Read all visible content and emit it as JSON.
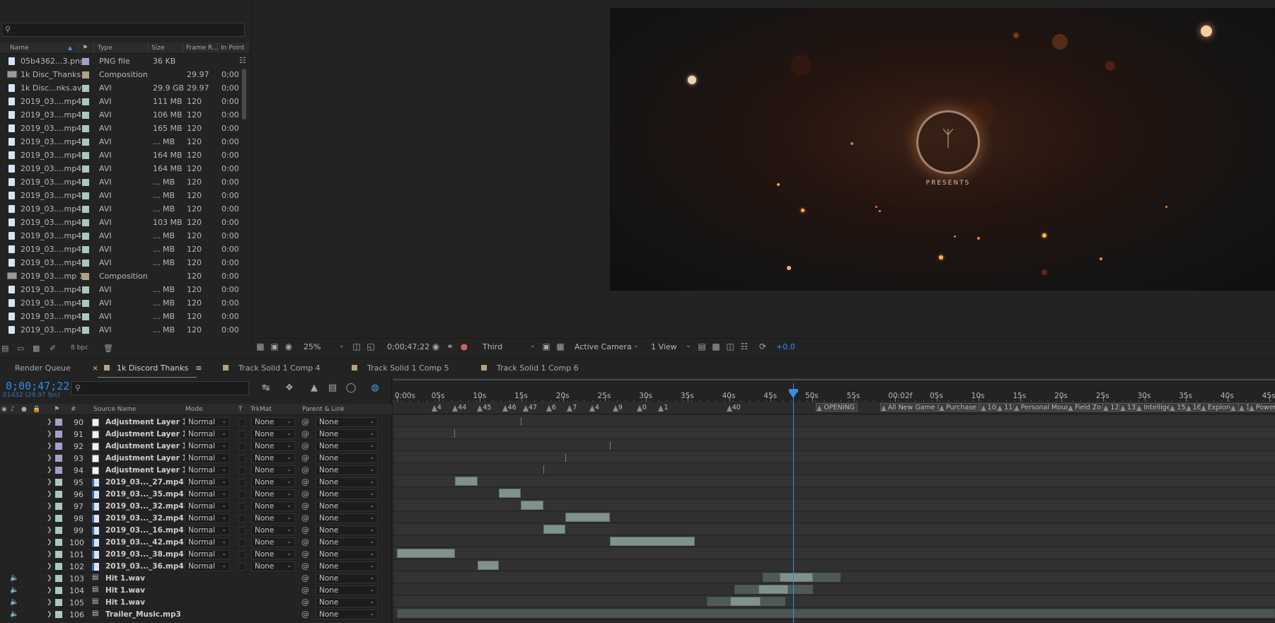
{
  "project": {
    "search_placeholder": "",
    "headers": {
      "name": "Name",
      "type": "Type",
      "size": "Size",
      "frame_rate": "Frame R...",
      "in_point": "In Point"
    },
    "items": [
      {
        "name": "05b4362...3.png",
        "type": "PNG file",
        "size": "36 KB",
        "rate": "",
        "in": "",
        "kind": "file",
        "label": "#a89fc8"
      },
      {
        "name": "1k Disc_Thanks",
        "type": "Composition",
        "size": "",
        "rate": "29.97",
        "in": "0;00",
        "kind": "comp",
        "label": "#b39e84"
      },
      {
        "name": "1k Disc...nks.avi",
        "type": "AVI",
        "size": "29.9 GB",
        "rate": "29.97",
        "in": "0;00",
        "kind": "file",
        "label": "#a9c9bd"
      },
      {
        "name": "2019_03....mp4",
        "type": "AVI",
        "size": "111 MB",
        "rate": "120",
        "in": "0:00",
        "kind": "file",
        "label": "#a9c9bd"
      },
      {
        "name": "2019_03....mp4",
        "type": "AVI",
        "size": "106 MB",
        "rate": "120",
        "in": "0:00",
        "kind": "file",
        "label": "#a9c9bd"
      },
      {
        "name": "2019_03....mp4",
        "type": "AVI",
        "size": "165 MB",
        "rate": "120",
        "in": "0:00",
        "kind": "file",
        "label": "#a9c9bd"
      },
      {
        "name": "2019_03....mp4",
        "type": "AVI",
        "size": "... MB",
        "rate": "120",
        "in": "0:00",
        "kind": "file",
        "label": "#a9c9bd"
      },
      {
        "name": "2019_03....mp4",
        "type": "AVI",
        "size": "164 MB",
        "rate": "120",
        "in": "0:00",
        "kind": "file",
        "label": "#a9c9bd"
      },
      {
        "name": "2019_03....mp4",
        "type": "AVI",
        "size": "164 MB",
        "rate": "120",
        "in": "0:00",
        "kind": "file",
        "label": "#a9c9bd"
      },
      {
        "name": "2019_03....mp4",
        "type": "AVI",
        "size": "... MB",
        "rate": "120",
        "in": "0:00",
        "kind": "file",
        "label": "#a9c9bd"
      },
      {
        "name": "2019_03....mp4",
        "type": "AVI",
        "size": "... MB",
        "rate": "120",
        "in": "0:00",
        "kind": "file",
        "label": "#a9c9bd"
      },
      {
        "name": "2019_03....mp4",
        "type": "AVI",
        "size": "... MB",
        "rate": "120",
        "in": "0:00",
        "kind": "file",
        "label": "#a9c9bd"
      },
      {
        "name": "2019_03....mp4",
        "type": "AVI",
        "size": "103 MB",
        "rate": "120",
        "in": "0:00",
        "kind": "file",
        "label": "#a9c9bd"
      },
      {
        "name": "2019_03....mp4",
        "type": "AVI",
        "size": "... MB",
        "rate": "120",
        "in": "0:00",
        "kind": "file",
        "label": "#a9c9bd"
      },
      {
        "name": "2019_03....mp4",
        "type": "AVI",
        "size": "... MB",
        "rate": "120",
        "in": "0:00",
        "kind": "file",
        "label": "#a9c9bd"
      },
      {
        "name": "2019_03....mp4",
        "type": "AVI",
        "size": "... MB",
        "rate": "120",
        "in": "0:00",
        "kind": "file",
        "label": "#a9c9bd"
      },
      {
        "name": "2019_03....mp 1",
        "type": "Composition",
        "size": "",
        "rate": "120",
        "in": "0:00",
        "kind": "comp",
        "label": "#b39e84"
      },
      {
        "name": "2019_03....mp4",
        "type": "AVI",
        "size": "... MB",
        "rate": "120",
        "in": "0:00",
        "kind": "file",
        "label": "#a9c9bd"
      },
      {
        "name": "2019_03....mp4",
        "type": "AVI",
        "size": "... MB",
        "rate": "120",
        "in": "0:00",
        "kind": "file",
        "label": "#a9c9bd"
      },
      {
        "name": "2019_03....mp4",
        "type": "AVI",
        "size": "... MB",
        "rate": "120",
        "in": "0:00",
        "kind": "file",
        "label": "#a9c9bd"
      },
      {
        "name": "2019_03....mp4",
        "type": "AVI",
        "size": "... MB",
        "rate": "120",
        "in": "0:00",
        "kind": "file",
        "label": "#a9c9bd"
      }
    ],
    "bpc": "8 bpc"
  },
  "viewer": {
    "presents": "PRESENTS",
    "zoom": "25%",
    "timecode": "0;00;47;22",
    "resolution": "Third",
    "camera": "Active Camera",
    "views": "1 View",
    "exposure": "+0.0"
  },
  "tabs": [
    {
      "label": "Render Queue",
      "has_square": false
    },
    {
      "label": "1k Discord Thanks",
      "has_square": true,
      "active": true
    },
    {
      "label": "Track Solid 1 Comp 4",
      "has_square": true
    },
    {
      "label": "Track Solid 1 Comp 5",
      "has_square": true
    },
    {
      "label": "Track Solid 1 Comp 6",
      "has_square": true
    }
  ],
  "timeline": {
    "timecode": "0;00;47;22",
    "frame_info": "01432 (29.97 fps)",
    "headers": {
      "num": "#",
      "source": "Source Name",
      "mode": "Mode",
      "t": "T",
      "trkmat": "TrkMat",
      "parent": "Parent & Link"
    },
    "ruler_labels": [
      "0:00s",
      "05s",
      "10s",
      "15s",
      "20s",
      "25s",
      "30s",
      "35s",
      "40s",
      "45s",
      "50s",
      "55s",
      "00:02f",
      "05s",
      "10s",
      "15s",
      "20s",
      "25s",
      "30s",
      "35s",
      "40s",
      "45s"
    ],
    "markers": [
      {
        "t": 4.5,
        "label": "4",
        "box": false
      },
      {
        "t": 7.0,
        "label": "44",
        "box": false
      },
      {
        "t": 10.0,
        "label": "45",
        "box": false
      },
      {
        "t": 13.0,
        "label": "46",
        "box": false
      },
      {
        "t": 15.5,
        "label": "47",
        "box": false
      },
      {
        "t": 18.3,
        "label": "6",
        "box": false
      },
      {
        "t": 20.8,
        "label": "7",
        "box": false
      },
      {
        "t": 23.5,
        "label": "4",
        "box": false
      },
      {
        "t": 26.3,
        "label": "9",
        "box": false
      },
      {
        "t": 29.2,
        "label": "0",
        "box": false
      },
      {
        "t": 31.8,
        "label": "1",
        "box": false
      },
      {
        "t": 40.0,
        "label": "40",
        "box": false
      },
      {
        "t": 50.8,
        "label": "OPENING",
        "box": true
      },
      {
        "t": 58.5,
        "label": "All New Game Mo",
        "box": true
      },
      {
        "t": 65.5,
        "label": "Purchase",
        "box": true
      },
      {
        "t": 70.5,
        "label": "10",
        "box": true
      },
      {
        "t": 72.5,
        "label": "11",
        "box": true
      },
      {
        "t": 74.5,
        "label": "Personal Mount",
        "box": true
      },
      {
        "t": 81.0,
        "label": "Field Zo",
        "box": true
      },
      {
        "t": 85.3,
        "label": "12",
        "box": true
      },
      {
        "t": 87.3,
        "label": "13",
        "box": true
      },
      {
        "t": 89.3,
        "label": "Intellige",
        "box": true
      },
      {
        "t": 93.3,
        "label": "15",
        "box": true
      },
      {
        "t": 95.2,
        "label": "16",
        "box": true
      },
      {
        "t": 97.0,
        "label": "Explore",
        "box": true
      },
      {
        "t": 100.6,
        "label": "1",
        "box": true
      },
      {
        "t": 101.6,
        "label": "1",
        "box": true
      },
      {
        "t": 102.8,
        "label": "Power",
        "box": true
      }
    ],
    "current_time_s": 47.73,
    "layers": [
      {
        "num": "90",
        "name": "Adjustment Layer 1",
        "kind": "adj",
        "mode": "Normal",
        "trkmat": "None",
        "parent": "None",
        "label": "#a89fc8",
        "audio": false,
        "bar": null,
        "kf": 14.9
      },
      {
        "num": "91",
        "name": "Adjustment Layer 1",
        "kind": "adj",
        "mode": "Normal",
        "trkmat": "None",
        "parent": "None",
        "label": "#a89fc8",
        "audio": false,
        "bar": null,
        "kf": 6.9
      },
      {
        "num": "92",
        "name": "Adjustment Layer 1",
        "kind": "adj",
        "mode": "Normal",
        "trkmat": "None",
        "parent": "None",
        "label": "#a89fc8",
        "audio": false,
        "bar": null,
        "kf": 25.6
      },
      {
        "num": "93",
        "name": "Adjustment Layer 1",
        "kind": "adj",
        "mode": "Normal",
        "trkmat": "None",
        "parent": "None",
        "label": "#a89fc8",
        "audio": false,
        "bar": null,
        "kf": 20.3
      },
      {
        "num": "94",
        "name": "Adjustment Layer 1",
        "kind": "adj",
        "mode": "Normal",
        "trkmat": "None",
        "parent": "None",
        "label": "#a89fc8",
        "audio": false,
        "bar": null,
        "kf": 17.6
      },
      {
        "num": "95",
        "name": "2019_03..._27.mp4",
        "kind": "vid",
        "mode": "Normal",
        "trkmat": "None",
        "parent": "None",
        "label": "#a9c9bd",
        "audio": false,
        "bar": [
          7.0,
          9.7
        ],
        "kf": null
      },
      {
        "num": "96",
        "name": "2019_03..._35.mp4",
        "kind": "vid",
        "mode": "Normal",
        "trkmat": "None",
        "parent": "None",
        "label": "#a9c9bd",
        "audio": false,
        "bar": [
          12.3,
          14.9
        ],
        "kf": null
      },
      {
        "num": "97",
        "name": "2019_03..._32.mp4",
        "kind": "vid",
        "mode": "Normal",
        "trkmat": "None",
        "parent": "None",
        "label": "#a9c9bd",
        "audio": false,
        "bar": [
          14.9,
          17.6
        ],
        "kf": null
      },
      {
        "num": "98",
        "name": "2019_03..._32.mp4",
        "kind": "vid",
        "mode": "Normal",
        "trkmat": "None",
        "parent": "None",
        "label": "#a9c9bd",
        "audio": false,
        "bar": [
          20.3,
          25.6
        ],
        "kf": null
      },
      {
        "num": "99",
        "name": "2019_03..._16.mp4",
        "kind": "vid",
        "mode": "Normal",
        "trkmat": "None",
        "parent": "None",
        "label": "#a9c9bd",
        "audio": false,
        "bar": [
          17.6,
          20.3
        ],
        "kf": null
      },
      {
        "num": "100",
        "name": "2019_03..._42.mp4",
        "kind": "vid",
        "mode": "Normal",
        "trkmat": "None",
        "parent": "None",
        "label": "#a9c9bd",
        "audio": false,
        "bar": [
          25.6,
          35.9
        ],
        "kf": null
      },
      {
        "num": "101",
        "name": "2019_03..._38.mp4",
        "kind": "vid",
        "mode": "Normal",
        "trkmat": "None",
        "parent": "None",
        "label": "#a9c9bd",
        "audio": false,
        "bar": [
          0.0,
          7.0
        ],
        "kf": null
      },
      {
        "num": "102",
        "name": "2019_03..._36.mp4",
        "kind": "vid",
        "mode": "Normal",
        "trkmat": "None",
        "parent": "None",
        "label": "#a9c9bd",
        "audio": false,
        "bar": [
          9.7,
          12.3
        ],
        "kf": null
      },
      {
        "num": "103",
        "name": "Hit 1.wav",
        "kind": "aud",
        "mode": "",
        "trkmat": "",
        "parent": "None",
        "label": "#a9c9bd",
        "audio": true,
        "bar": [
          46.1,
          50.1
        ],
        "faint": [
          44.0,
          53.4
        ],
        "kf": null
      },
      {
        "num": "104",
        "name": "Hit 1.wav",
        "kind": "aud",
        "mode": "",
        "trkmat": "",
        "parent": "None",
        "label": "#a9c9bd",
        "audio": true,
        "bar": [
          43.5,
          47.1
        ],
        "faint": [
          40.6,
          50.1
        ],
        "kf": null
      },
      {
        "num": "105",
        "name": "Hit 1.wav",
        "kind": "aud",
        "mode": "",
        "trkmat": "",
        "parent": "None",
        "label": "#a9c9bd",
        "audio": true,
        "bar": [
          40.1,
          43.8
        ],
        "faint": [
          37.3,
          46.8
        ],
        "kf": null
      },
      {
        "num": "106",
        "name": "Trailer_Music.mp3",
        "kind": "aud",
        "mode": "",
        "trkmat": "",
        "parent": "None",
        "label": "#a9c9bd",
        "audio": true,
        "bar": [
          0.0,
          125.0
        ],
        "kf": null
      }
    ]
  }
}
